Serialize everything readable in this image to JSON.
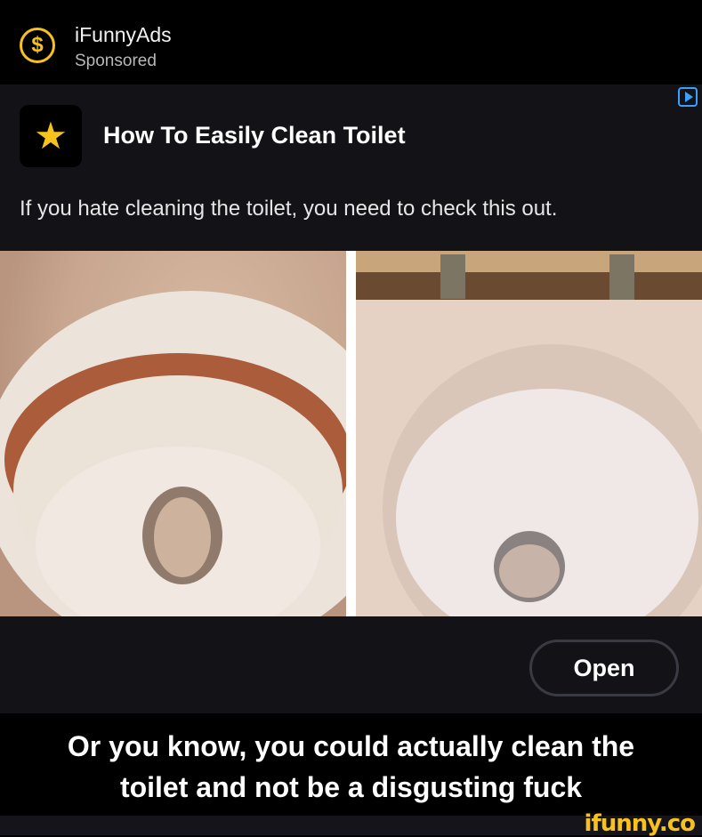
{
  "header": {
    "advertiser": "iFunnyAds",
    "sponsored_label": "Sponsored",
    "badge_symbol": "$"
  },
  "ad": {
    "title": "How To Easily Clean Toilet",
    "description": "If you hate cleaning the toilet, you need to check this out.",
    "open_label": "Open",
    "icon": "star-icon",
    "icon_symbol": "★"
  },
  "caption": {
    "line1": "Or you know, you could actually clean the",
    "line2": "toilet and not be a disgusting fuck"
  },
  "watermark": "ifunny.co",
  "colors": {
    "accent": "#f7c21e",
    "card_background": "#121217",
    "adchoices": "#3aa0ff"
  }
}
